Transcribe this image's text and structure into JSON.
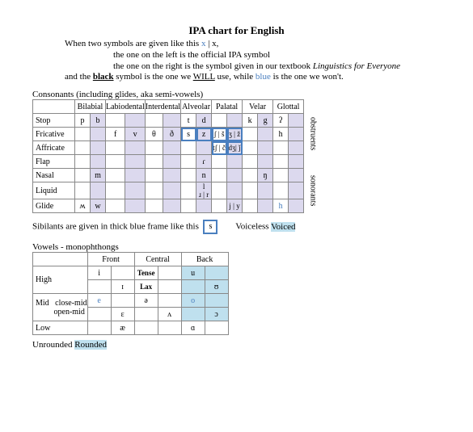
{
  "title": "IPA  chart  for English",
  "intro": {
    "l1a": "When two symbols are given like this ",
    "l1b": "x",
    "l1c": " | x,",
    "l2": "the one on the left is the official IPA symbol",
    "l3a": "the one on the right is the symbol given in our textbook ",
    "l3b": "Linguistics for Everyone",
    "l4a": "and the ",
    "l4b": "black",
    "l4c": " symbol is the one we ",
    "l4d": "WILL",
    "l4e": " use, while ",
    "l4f": "blue",
    "l4g": " is the one we won't."
  },
  "cons_label": "Consonants (including glides, aka semi-vowels)",
  "cols": {
    "c1": "Bilabial",
    "c2": "Labiodental",
    "c3": "Interdental",
    "c4": "Alveolar",
    "c5": "Palatal",
    "c6": "Velar",
    "c7": "Glottal"
  },
  "rows": {
    "r1": "Stop",
    "r2": "Fricative",
    "r3": "Affricate",
    "r4": "Flap",
    "r5": "Nasal",
    "r6": "Liquid",
    "r7": "Glide"
  },
  "c": {
    "p": "p",
    "b": "b",
    "t": "t",
    "d": "d",
    "k": "k",
    "g": "g",
    "glot": "ʔ",
    "f": "f",
    "v": "v",
    "th": "θ",
    "dh": "ð",
    "s": "s",
    "z": "z",
    "sh": "ʃ | š",
    "zh": "ʒ | ž",
    "h": "h",
    "ch": "tʃ | č",
    "jh": "dʒ| ǰ",
    "flap": "ɾ",
    "m": "m",
    "n": "n",
    "ng": "ŋ",
    "l": "l",
    "r": "ɹ | r",
    "wv": "ʍ",
    "w": "w",
    "j": "j | y",
    "hg": "h"
  },
  "side": {
    "obs": "obstruents",
    "son": "sonorants"
  },
  "sibline": {
    "a": "Sibilants are given in thick blue frame like this",
    "s": "s",
    "b": "Voiceless ",
    "c": "Voiced"
  },
  "vlabel": "Vowels - monophthongs",
  "vcols": {
    "c1": "Front",
    "c2": "Central",
    "c3": "Back"
  },
  "vtoprow": {
    "a": "Tense",
    "b": "Lax"
  },
  "vrows": {
    "r1": "High",
    "r2a": "Mid",
    "r2b": "close-mid",
    "r2c": "open-mid",
    "r3": "Low"
  },
  "v": {
    "i": "i",
    "I": "ɪ",
    "u": "u",
    "U": "ʊ",
    "e": "e",
    "eps": "ɛ",
    "sch": "ə",
    "car": "ʌ",
    "o": "o",
    "oc": "ɔ",
    "ae": "æ",
    "a": "ɑ"
  },
  "round": {
    "a": "Unrounded ",
    "b": "Rounded"
  }
}
